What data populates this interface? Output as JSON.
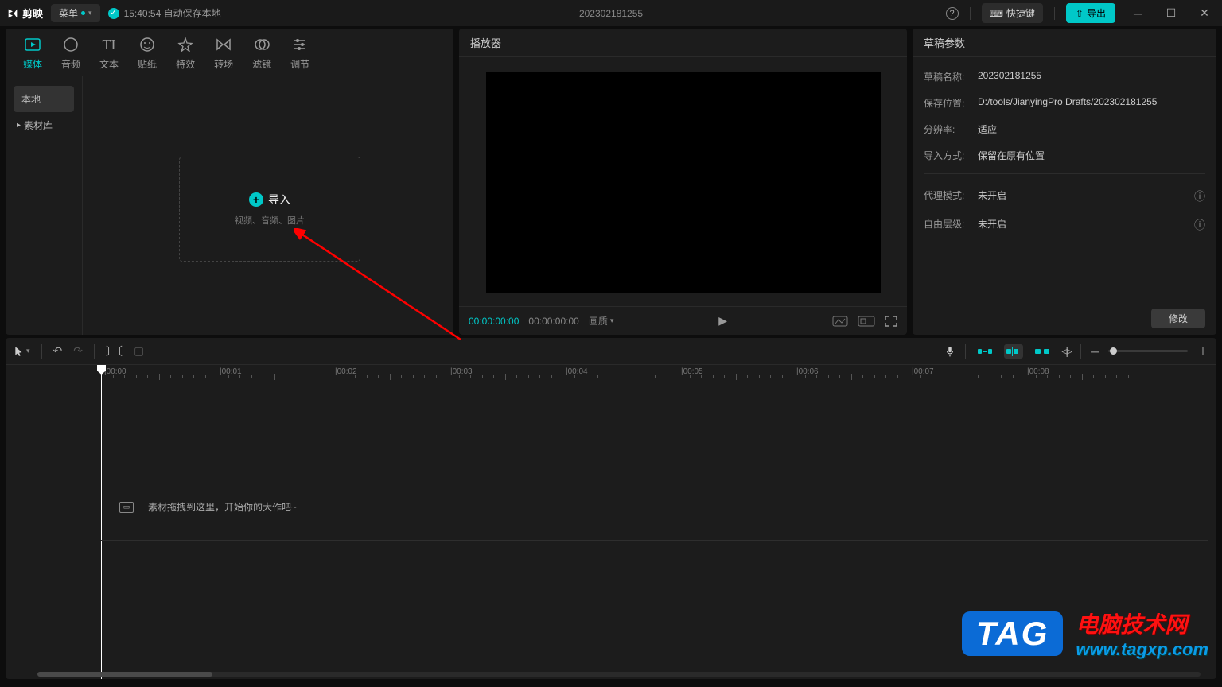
{
  "titlebar": {
    "app": "剪映",
    "menu": "菜单",
    "autosave": "15:40:54 自动保存本地",
    "project": "202302181255",
    "shortcut": "快捷键",
    "export": "导出"
  },
  "mediaTabs": [
    {
      "icon": "▸",
      "label": "媒体"
    },
    {
      "icon": "◐",
      "label": "音频"
    },
    {
      "icon": "TI",
      "label": "文本"
    },
    {
      "icon": "✧",
      "label": "贴纸"
    },
    {
      "icon": "✦",
      "label": "特效"
    },
    {
      "icon": "⋈",
      "label": "转场"
    },
    {
      "icon": "◎",
      "label": "滤镜"
    },
    {
      "icon": "⇅",
      "label": "调节"
    }
  ],
  "mediaSide": {
    "local": "本地",
    "library": "素材库"
  },
  "import": {
    "label": "导入",
    "sub": "视频、音频、图片"
  },
  "player": {
    "title": "播放器",
    "cur": "00:00:00:00",
    "total": "00:00:00:00",
    "quality": "画质"
  },
  "props": {
    "title": "草稿参数",
    "rows": [
      {
        "label": "草稿名称:",
        "value": "202302181255"
      },
      {
        "label": "保存位置:",
        "value": "D:/tools/JianyingPro Drafts/202302181255"
      },
      {
        "label": "分辨率:",
        "value": "适应"
      },
      {
        "label": "导入方式:",
        "value": "保留在原有位置"
      }
    ],
    "rows2": [
      {
        "label": "代理模式:",
        "value": "未开启"
      },
      {
        "label": "自由层级:",
        "value": "未开启"
      }
    ],
    "modify": "修改"
  },
  "ruler": [
    "00:00",
    "00:01",
    "00:02",
    "00:03",
    "00:04",
    "00:05",
    "00:06",
    "00:07",
    "00:08"
  ],
  "timelineHint": "素材拖拽到这里，开始你的大作吧~",
  "watermark": {
    "tag": "TAG",
    "line1": "电脑技术网",
    "line2": "www.tagxp.com"
  }
}
